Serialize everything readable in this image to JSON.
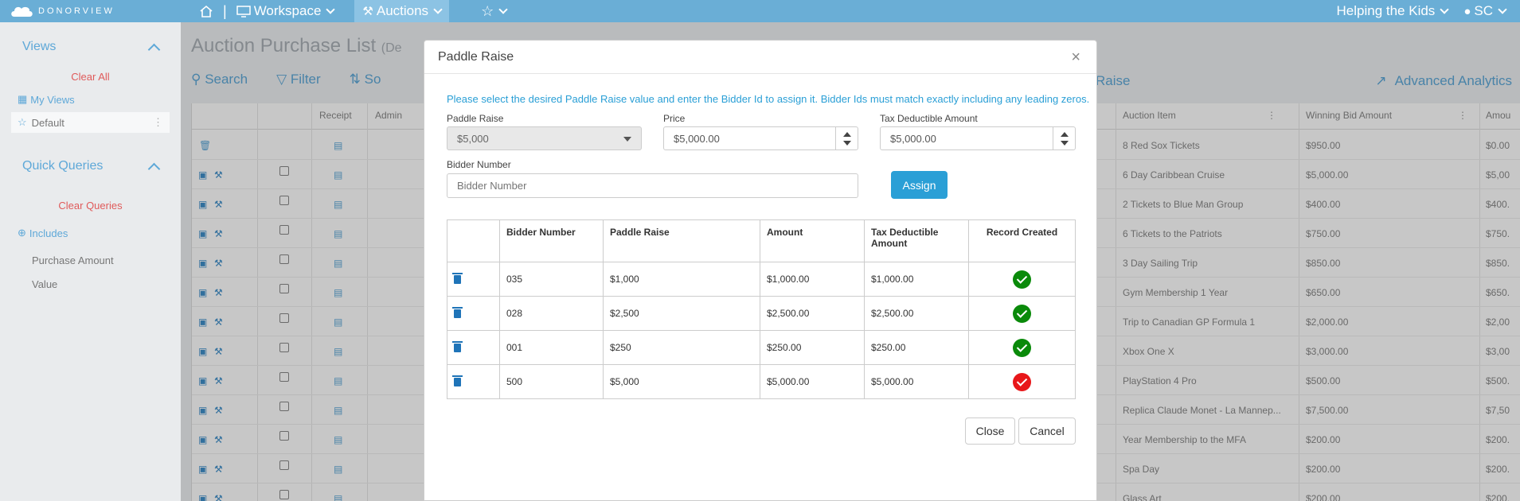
{
  "topbar": {
    "logo_text": "DONORVIEW",
    "workspace": "Workspace",
    "auctions": "Auctions",
    "org": "Helping the Kids",
    "user": "SC",
    "color": "#6aaed6"
  },
  "sidebar": {
    "views_title": "Views",
    "clear_all": "Clear All",
    "my_views": "My Views",
    "default": "Default",
    "quick_queries_title": "Quick Queries",
    "clear_queries": "Clear Queries",
    "includes": "Includes",
    "items": [
      "Purchase Amount",
      "Value"
    ]
  },
  "page": {
    "title": "Auction Purchase List",
    "title_suffix": "(De",
    "search": "Search",
    "filter": "Filter",
    "sort": "So",
    "raise": "Raise",
    "advanced_analytics": "Advanced Analytics",
    "columns": {
      "receipt": "Receipt",
      "admin": "Admin",
      "auction_item": "Auction Item",
      "winning_bid": "Winning Bid Amount",
      "amount": "Amou"
    },
    "rows": [
      {
        "item": "8 Red Sox Tickets",
        "bid": "$950.00",
        "amount": "$0.00"
      },
      {
        "item": "6 Day Caribbean Cruise",
        "bid": "$5,000.00",
        "amount": "$5,00"
      },
      {
        "item": "2 Tickets to Blue Man Group",
        "bid": "$400.00",
        "amount": "$400."
      },
      {
        "item": "6 Tickets to the Patriots",
        "bid": "$750.00",
        "amount": "$750."
      },
      {
        "item": "3 Day Sailing Trip",
        "bid": "$850.00",
        "amount": "$850."
      },
      {
        "item": "Gym Membership 1 Year",
        "bid": "$650.00",
        "amount": "$650."
      },
      {
        "item": "Trip to Canadian GP Formula 1",
        "bid": "$2,000.00",
        "amount": "$2,00"
      },
      {
        "item": "Xbox One X",
        "bid": "$3,000.00",
        "amount": "$3,00"
      },
      {
        "item": "PlayStation 4 Pro",
        "bid": "$500.00",
        "amount": "$500."
      },
      {
        "item": "Replica Claude Monet - La Mannep...",
        "bid": "$7,500.00",
        "amount": "$7,50"
      },
      {
        "item": "Year Membership to the MFA",
        "bid": "$200.00",
        "amount": "$200."
      },
      {
        "item": "Spa Day",
        "bid": "$200.00",
        "amount": "$200."
      },
      {
        "item": "Glass Art",
        "bid": "$200.00",
        "amount": "$200."
      }
    ]
  },
  "modal": {
    "title": "Paddle Raise",
    "info": "Please select the desired Paddle Raise value and enter the Bidder Id to assign it. Bidder Ids must match exactly including any leading zeros.",
    "paddle_raise_label": "Paddle Raise",
    "paddle_raise_value": "$5,000",
    "price_label": "Price",
    "price_value": "$5,000.00",
    "tax_label": "Tax Deductible Amount",
    "tax_value": "$5,000.00",
    "bidder_label": "Bidder Number",
    "bidder_placeholder": "Bidder Number",
    "assign": "Assign",
    "table": {
      "headers": [
        "Bidder Number",
        "Paddle Raise",
        "Amount",
        "Tax Deductible Amount",
        "Record Created"
      ],
      "rows": [
        {
          "bidder": "035",
          "raise": "$1,000",
          "amount": "$1,000.00",
          "tax": "$1,000.00",
          "status": "success"
        },
        {
          "bidder": "028",
          "raise": "$2,500",
          "amount": "$2,500.00",
          "tax": "$2,500.00",
          "status": "success"
        },
        {
          "bidder": "001",
          "raise": "$250",
          "amount": "$250.00",
          "tax": "$250.00",
          "status": "success"
        },
        {
          "bidder": "500",
          "raise": "$5,000",
          "amount": "$5,000.00",
          "tax": "$5,000.00",
          "status": "error"
        }
      ]
    },
    "close": "Close",
    "cancel": "Cancel",
    "success_color": "#0a8a0a",
    "error_color": "#e8171a"
  }
}
